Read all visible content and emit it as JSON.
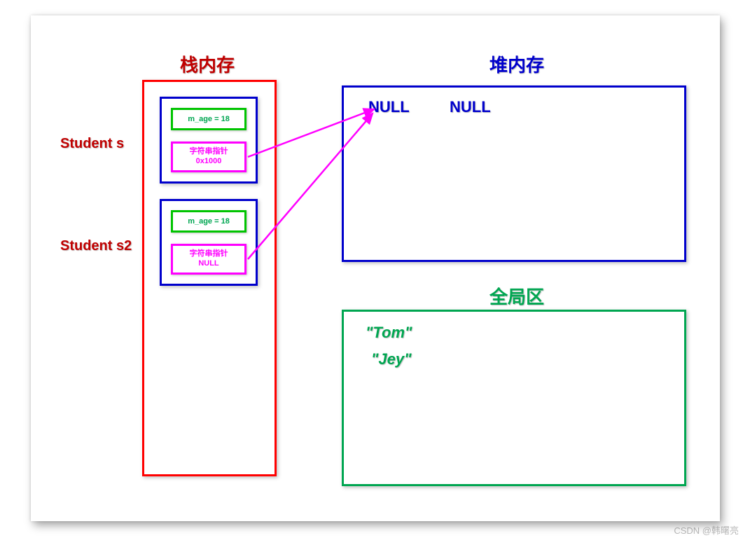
{
  "titles": {
    "stack": "栈内存",
    "heap": "堆内存",
    "global": "全局区"
  },
  "labels": {
    "s": "Student s",
    "s2": "Student s2"
  },
  "struct1": {
    "age": "m_age = 18",
    "ptr_label": "字符串指针",
    "ptr_value": "0x1000"
  },
  "struct2": {
    "age": "m_age = 18",
    "ptr_label": "字符串指针",
    "ptr_value": "NULL"
  },
  "heap": {
    "null1": "NULL",
    "null2": "NULL"
  },
  "global": {
    "tom": "\"Tom\"",
    "jey": "\"Jey\""
  },
  "watermark": "CSDN @韩曙亮"
}
